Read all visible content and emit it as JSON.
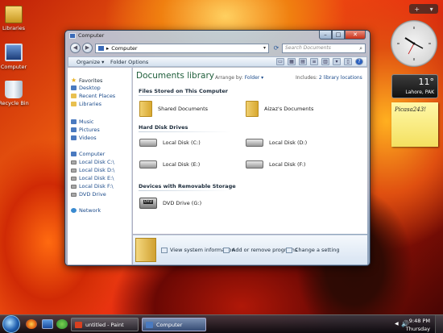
{
  "desktop": {
    "icons": [
      {
        "label": "Libraries"
      },
      {
        "label": "Computer"
      },
      {
        "label": "Recycle Bin"
      }
    ]
  },
  "gadgets": {
    "toolbar": {
      "add": "+",
      "menu": "▾"
    },
    "weather": {
      "temp": "11°",
      "city": "Lahore, PAK"
    },
    "note": {
      "text": "Picasa243!"
    }
  },
  "window": {
    "title": "Computer",
    "address": "Computer",
    "search_placeholder": "Search Documents",
    "toolbar": {
      "organize": "Organize ▾",
      "folder_options": "Folder Options"
    },
    "nav": {
      "favorites": "Favorites",
      "desktop": "Desktop",
      "recent": "Recent Places",
      "libraries": "Libraries",
      "music": "Music",
      "pictures": "Pictures",
      "videos": "Videos",
      "computer": "Computer",
      "c": "Local Disk C:\\",
      "d": "Local Disk D:\\",
      "e": "Local Disk E:\\",
      "f": "Local Disk F:\\",
      "dvd": "DVD Drive",
      "network": "Network"
    },
    "content": {
      "library_title": "Documents library",
      "arrange_label": "Arrange by:",
      "arrange_value": "Folder ▾",
      "includes_label": "Includes:",
      "includes_value": "2 library locations",
      "sections": {
        "files": "Files Stored on This Computer",
        "hdd": "Hard Disk Drives",
        "removable": "Devices with Removable Storage"
      },
      "items": {
        "shared": "Shared Documents",
        "user_docs": "Aizaz's Documents",
        "c": "Local Disk (C:)",
        "d": "Local Disk (D:)",
        "e": "Local Disk (E:)",
        "f": "Local Disk (F:)",
        "dvd": "DVD Drive (G:)"
      }
    },
    "details": {
      "sys_info": "View system information",
      "add_remove": "Add or remove programs",
      "change_setting": "Change a setting"
    }
  },
  "taskbar": {
    "tasks": [
      {
        "label": "untitled - Paint"
      },
      {
        "label": "Computer"
      }
    ],
    "tray": {
      "time": "9:48 PM",
      "day": "Thursday"
    }
  }
}
